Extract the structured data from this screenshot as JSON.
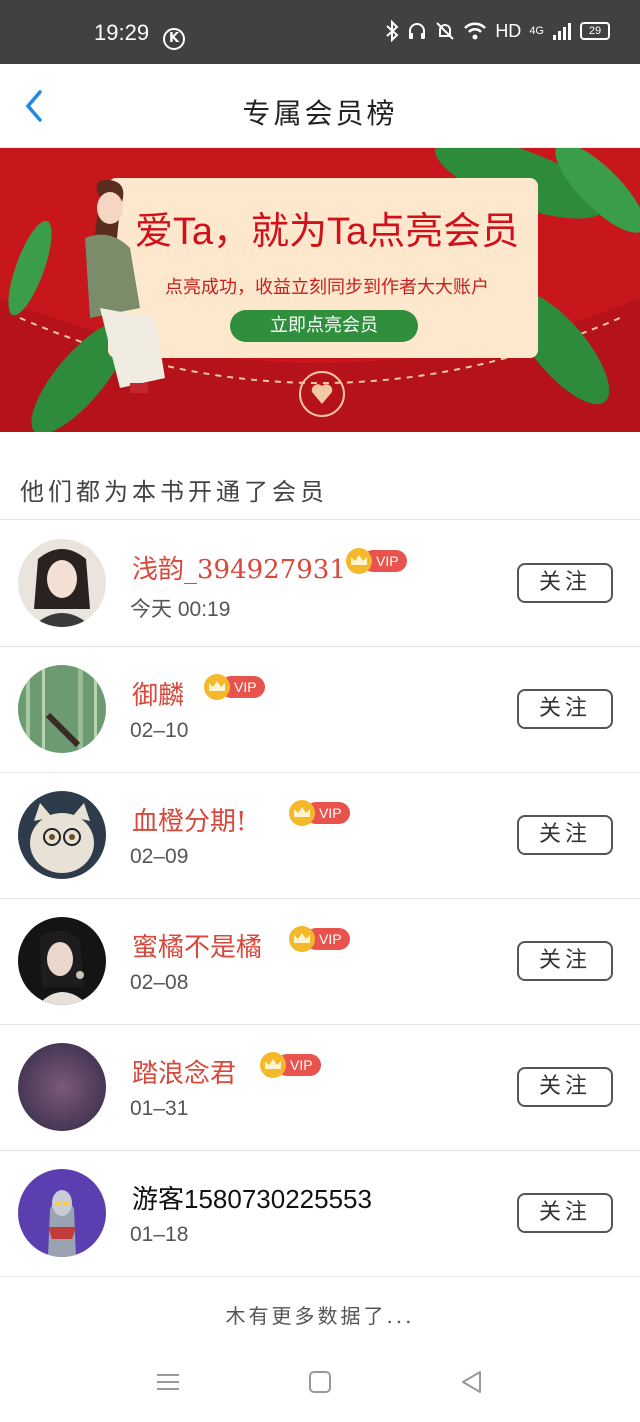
{
  "status_bar": {
    "time": "19:29",
    "k_badge": "K",
    "network": "HD",
    "net_gen": "4G",
    "battery": "29"
  },
  "nav": {
    "title": "专属会员榜",
    "back_icon": "chevron-left-icon"
  },
  "banner": {
    "title": "爱Ta，就为Ta点亮会员",
    "subtitle": "点亮成功，收益立刻同步到作者大大账户",
    "button": "立即点亮会员"
  },
  "section": {
    "title": "他们都为本书开通了会员"
  },
  "members": [
    {
      "name": "浅韵_394927931",
      "date": "今天 00:19",
      "vip": "VIP",
      "follow": "关注"
    },
    {
      "name": "御麟",
      "date": "02–10",
      "vip": "VIP",
      "follow": "关注"
    },
    {
      "name": "血橙分期!",
      "date": "02–09",
      "vip": "VIP",
      "follow": "关注"
    },
    {
      "name": "蜜橘不是橘",
      "date": "02–08",
      "vip": "VIP",
      "follow": "关注"
    },
    {
      "name": "踏浪念君",
      "date": "01–31",
      "vip": "VIP",
      "follow": "关注"
    },
    {
      "name": "游客1580730225553",
      "date": "01–18",
      "vip": "",
      "follow": "关注"
    }
  ],
  "footer": {
    "text": "木有更多数据了..."
  },
  "colors": {
    "accent_red": "#d9483b",
    "banner_red": "#c8161d",
    "vip_red": "#e9534d",
    "back_blue": "#1e88e5"
  }
}
